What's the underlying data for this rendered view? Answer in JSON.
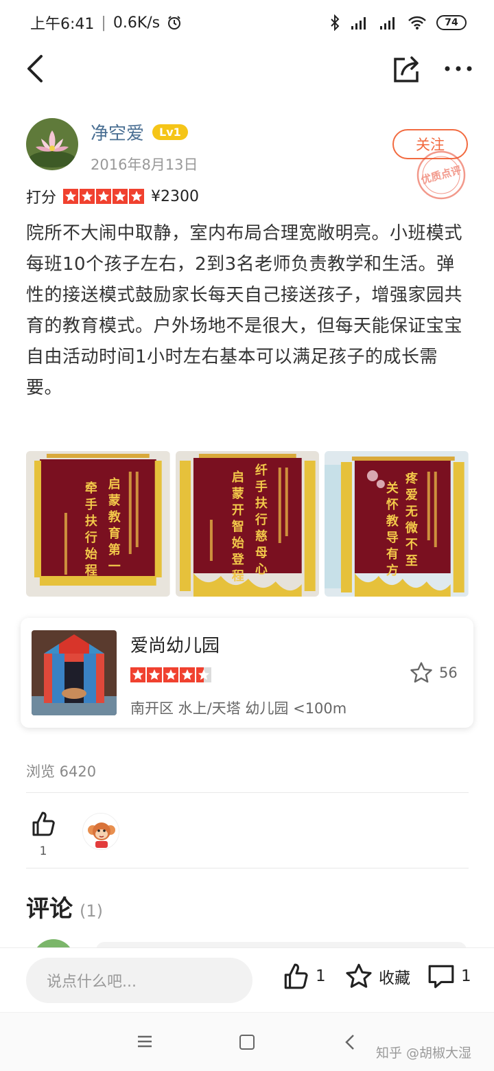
{
  "status_bar": {
    "time": "上午6:41",
    "separator": "|",
    "net_speed": "0.6K/s",
    "battery": "74"
  },
  "author": {
    "name": "净空爱",
    "level": "Lv1",
    "date": "2016年8月13日",
    "follow_label": "关注",
    "stamp_text": "优质点评"
  },
  "rating": {
    "label": "打分",
    "stars": 5,
    "price": "¥2300"
  },
  "review_text": "院所不大闹中取静，室内布局合理宽敞明亮。小班模式每班10个孩子左右，2到3名老师负责教学和生活。弹性的接送模式鼓励家长每天自己接送孩子，增强家园共育的教育模式。户外场地不是很大，但每天能保证宝宝自由活动时间1小时左右基本可以满足孩子的成长需要。",
  "shop": {
    "name": "爱尚幼儿园",
    "stars": 4.5,
    "favorites": "56",
    "meta": "南开区 水上/天塔 幼儿园 <100m"
  },
  "views": "浏览 6420",
  "likes": {
    "count": "1"
  },
  "comments": {
    "title": "评论",
    "count": "(1)"
  },
  "action_bar": {
    "placeholder": "说点什么吧...",
    "like_count": "1",
    "collect_label": "收藏",
    "comment_count": "1"
  },
  "watermark": "知乎 @胡椒大湿",
  "colors": {
    "accent": "#f26a3f",
    "star_red": "#f0412f",
    "level_badge": "#f5c518",
    "author_blue": "#4a6f93"
  }
}
